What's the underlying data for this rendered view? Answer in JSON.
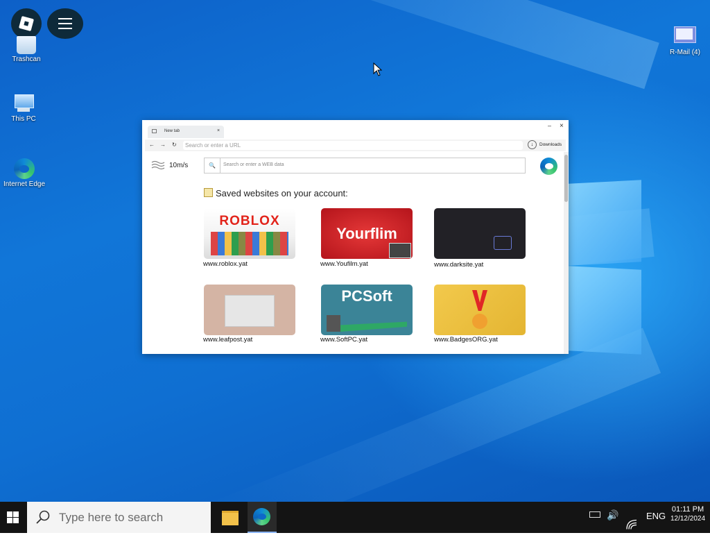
{
  "desktop": {
    "icons": [
      {
        "label": "Trashcan"
      },
      {
        "label": "This PC"
      },
      {
        "label": "Internet Edge"
      },
      {
        "label": "R-Mail (4)"
      }
    ]
  },
  "browser": {
    "tab_title": "New tab",
    "url_placeholder": "Search or enter a URL",
    "downloads_label": "Downloads",
    "speed": "10m/s",
    "search_placeholder": "Search or enter a WEB data",
    "saved_heading": "Saved websites on your account:",
    "sites": [
      {
        "title": "ROBLOX",
        "url": "www.roblox.yat"
      },
      {
        "title": "Yourflim",
        "url": "www.Youfilm.yat"
      },
      {
        "title": "",
        "url": "www.darksite.yat"
      },
      {
        "title": "",
        "url": "www.leafpost.yat"
      },
      {
        "title": "PCSoft",
        "url": "www.SoftPC.yat"
      },
      {
        "title": "",
        "url": "www.BadgesORG.yat"
      }
    ]
  },
  "taskbar": {
    "search_placeholder": "Type here to search",
    "language": "ENG",
    "time": "01:11 PM",
    "date": "12/12/2024"
  }
}
